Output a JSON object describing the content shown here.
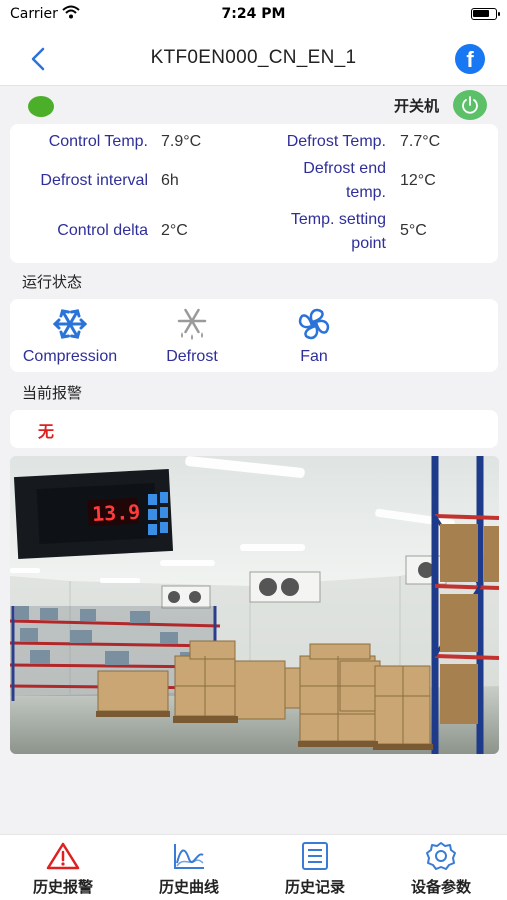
{
  "status_bar": {
    "carrier": "Carrier",
    "time": "7:24 PM"
  },
  "nav": {
    "title": "KTF0EN000_CN_EN_1",
    "facebook_glyph": "f"
  },
  "power": {
    "label": "开关机",
    "indicator_color": "#4caf2a",
    "button_color": "#5cc068"
  },
  "params": {
    "control_temp": {
      "label": "Control Temp.",
      "value": "7.9°C"
    },
    "defrost_temp": {
      "label": "Defrost Temp.",
      "value": "7.7°C"
    },
    "defrost_interval": {
      "label": "Defrost interval",
      "value": "6h"
    },
    "defrost_end_temp": {
      "label_line1": "Defrost end",
      "label_line2": "temp.",
      "value": "12°C"
    },
    "control_delta": {
      "label": "Control delta",
      "value": "2°C"
    },
    "temp_setting_point": {
      "label_line1": "Temp. setting",
      "label_line2": "point",
      "value": "5°C"
    }
  },
  "run_state": {
    "title": "运行状态",
    "items": [
      {
        "label": "Compression",
        "icon": "snowflake-icon"
      },
      {
        "label": "Defrost",
        "icon": "defrost-icon"
      },
      {
        "label": "Fan",
        "icon": "fan-icon"
      }
    ]
  },
  "alarm": {
    "title": "当前报警",
    "value": "无"
  },
  "photo": {
    "display_reading": "13.9"
  },
  "tabs": [
    {
      "label": "历史报警",
      "icon": "warning-icon"
    },
    {
      "label": "历史曲线",
      "icon": "chart-icon"
    },
    {
      "label": "历史记录",
      "icon": "list-icon"
    },
    {
      "label": "设备参数",
      "icon": "settings-icon"
    }
  ],
  "colors": {
    "accent": "#2f2f9a",
    "icon_blue": "#2a73d8",
    "alarm_red": "#e02020",
    "tab_icon": "#3a7bd5"
  }
}
